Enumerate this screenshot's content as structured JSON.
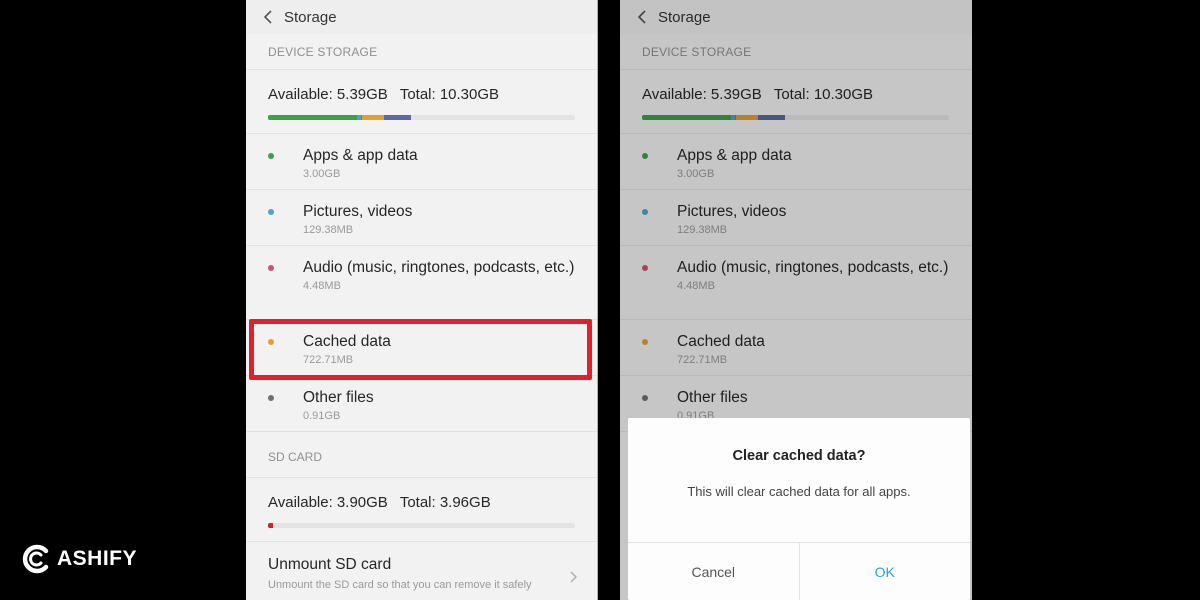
{
  "screen": {
    "title": "Storage",
    "device_storage_header": "DEVICE STORAGE",
    "device_available": "Available: 5.39GB",
    "device_total": "Total: 10.30GB",
    "usage_segments": [
      {
        "name": "apps",
        "fraction": 0.29,
        "color": "#3aa04a"
      },
      {
        "name": "pictures",
        "fraction": 0.013,
        "color": "#4aa5c8"
      },
      {
        "name": "audio",
        "fraction": 0.004,
        "color": "#d05070"
      },
      {
        "name": "cached",
        "fraction": 0.07,
        "color": "#e0a030"
      },
      {
        "name": "other",
        "fraction": 0.088,
        "color": "#5a6aa0"
      }
    ],
    "items": [
      {
        "label": "Apps & app data",
        "size": "3.00GB",
        "color": "#3aa04a"
      },
      {
        "label": "Pictures, videos",
        "size": "129.38MB",
        "color": "#4aa5c8"
      },
      {
        "label": "Audio (music, ringtones, podcasts, etc.)",
        "size": "4.48MB",
        "color": "#d05070"
      },
      {
        "label": "Cached data",
        "size": "722.71MB",
        "color": "#e0a030"
      },
      {
        "label": "Other files",
        "size": "0.91GB",
        "color": "#707070"
      }
    ],
    "sd_header": "SD CARD",
    "sd_available": "Available: 3.90GB",
    "sd_total": "Total: 3.96GB",
    "sd_used_fraction": 0.015,
    "sd_used_color": "#d0202a",
    "unmount_label": "Unmount SD card",
    "unmount_desc": "Unmount the SD card so that you can remove it safely"
  },
  "dialog": {
    "title": "Clear cached data?",
    "message": "This will clear cached data for all apps.",
    "cancel": "Cancel",
    "ok": "OK"
  },
  "watermark": "ASHIFY",
  "colors": {
    "highlight": "#e0202a",
    "ok_button": "#2aa3d6"
  }
}
